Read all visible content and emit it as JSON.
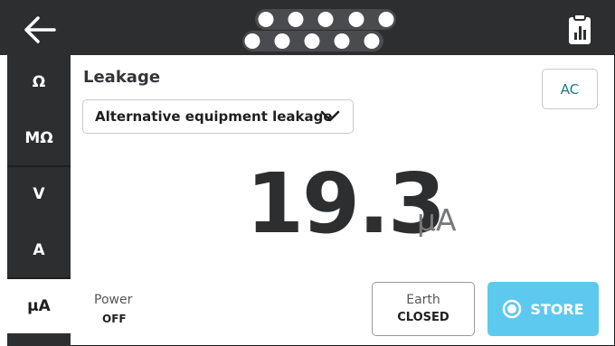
{
  "header": {
    "back_icon": "arrow-left-icon",
    "connector_icon": "connector-pins-icon",
    "report_icon": "clipboard-chart-icon"
  },
  "sidebar": {
    "items": [
      {
        "label": "Ω",
        "active": false
      },
      {
        "label": "MΩ",
        "active": false
      },
      {
        "label": "V",
        "active": false
      },
      {
        "label": "A",
        "active": false
      },
      {
        "label": "µA",
        "active": true
      }
    ]
  },
  "main": {
    "title": "Leakage",
    "dropdown_value": "Alternative equipment leakage",
    "mode_button": "AC",
    "reading": {
      "value": "19.3",
      "unit": "µA"
    },
    "power": {
      "label": "Power",
      "value": "OFF"
    },
    "earth": {
      "label": "Earth",
      "value": "CLOSED"
    },
    "store_label": "STORE"
  },
  "colors": {
    "topbar": "#2d2e30",
    "accent": "#5ec9ee",
    "ac_text": "#1a7a8f"
  }
}
